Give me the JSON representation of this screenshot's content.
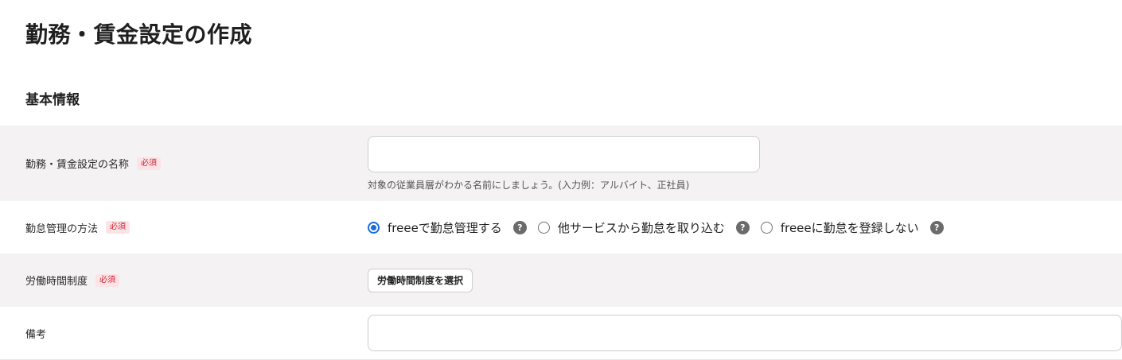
{
  "page": {
    "title": "勤務・賃金設定の作成"
  },
  "section": {
    "title": "基本情報"
  },
  "form": {
    "required_badge": "必須",
    "name_field": {
      "label": "勤務・賃金設定の名称",
      "value": "",
      "placeholder": "",
      "hint": "対象の従業員層がわかる名前にしましょう。(入力例：アルバイト、正社員)"
    },
    "attendance_method": {
      "label": "勤怠管理の方法",
      "selected": 0,
      "options": [
        {
          "label": "freeeで勤怠管理する",
          "help_icon": "question-circle-icon"
        },
        {
          "label": "他サービスから勤怠を取り込む",
          "help_icon": "question-circle-icon"
        },
        {
          "label": "freeeに勤怠を登録しない",
          "help_icon": "question-circle-icon"
        }
      ]
    },
    "work_system": {
      "label": "労働時間制度",
      "button_label": "労働時間制度を選択"
    },
    "notes": {
      "label": "備考",
      "value": ""
    }
  },
  "colors": {
    "accent": "#1b6ce0",
    "required_text": "#d4202f",
    "required_bg": "#fbe3e6",
    "row_shade": "#f4f2f3"
  }
}
